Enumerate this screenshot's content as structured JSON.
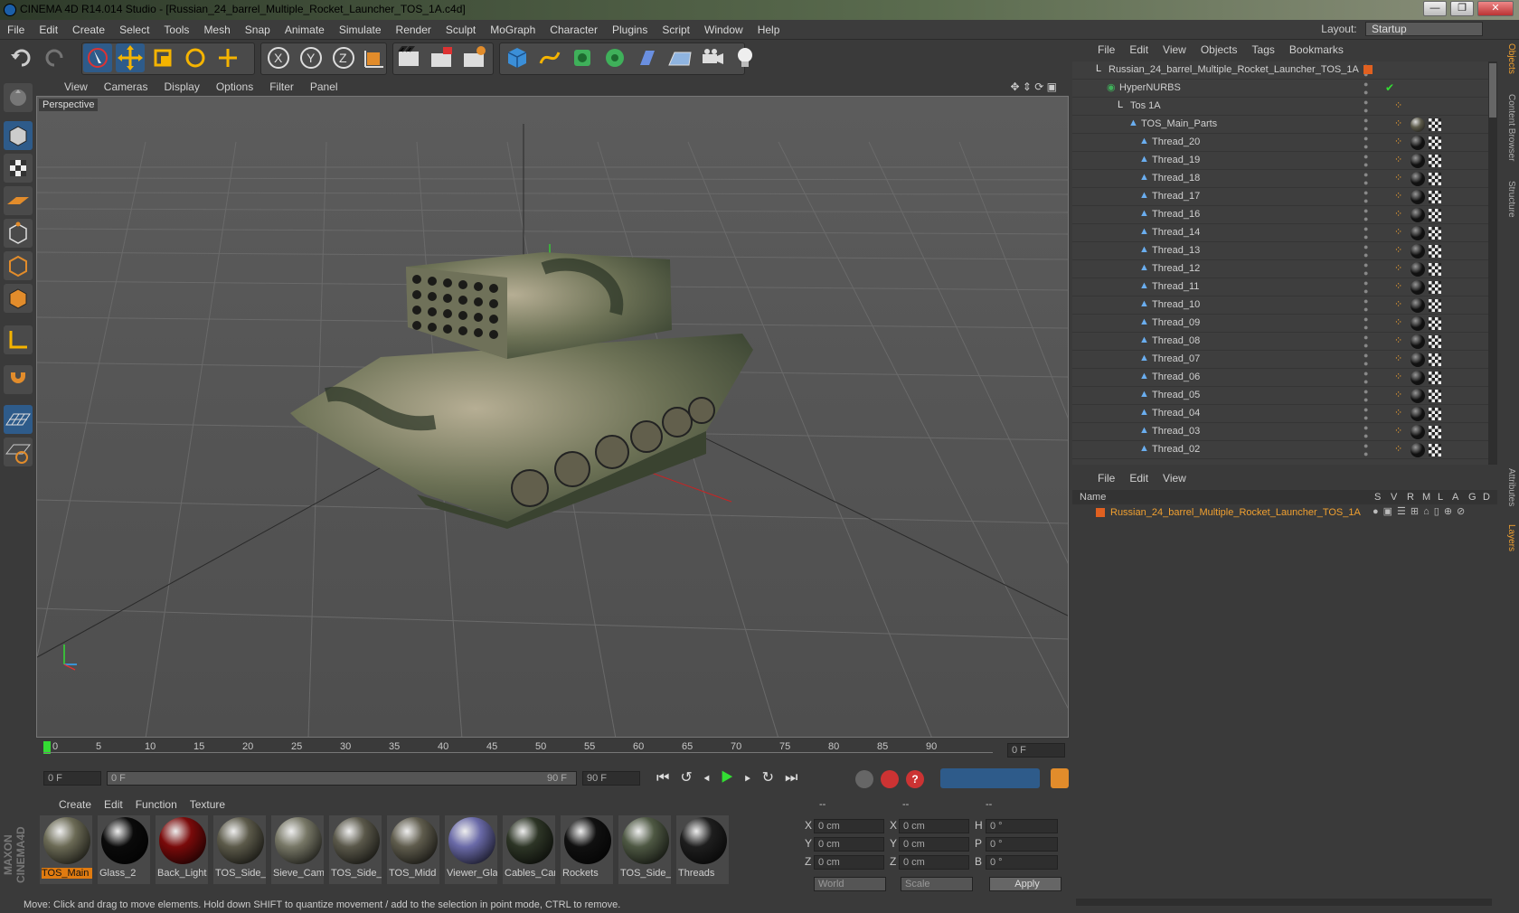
{
  "window": {
    "title": "CINEMA 4D R14.014 Studio - [Russian_24_barrel_Multiple_Rocket_Launcher_TOS_1A.c4d]",
    "buttons": [
      "—",
      "❐",
      "✕"
    ]
  },
  "menubar": {
    "items": [
      "File",
      "Edit",
      "Create",
      "Select",
      "Tools",
      "Mesh",
      "Snap",
      "Animate",
      "Simulate",
      "Render",
      "Sculpt",
      "MoGraph",
      "Character",
      "Plugins",
      "Script",
      "Window",
      "Help"
    ],
    "layout_label": "Layout:",
    "layout_value": "Startup"
  },
  "viewport": {
    "menu": [
      "View",
      "Cameras",
      "Display",
      "Options",
      "Filter",
      "Panel"
    ],
    "label": "Perspective"
  },
  "timeline": {
    "ticks": [
      "0",
      "5",
      "10",
      "15",
      "20",
      "25",
      "30",
      "35",
      "40",
      "45",
      "50",
      "55",
      "60",
      "65",
      "70",
      "75",
      "80",
      "85",
      "90"
    ],
    "frame_field": "0 F",
    "start_field": "0 F",
    "range_start": "0 F",
    "range_end": "90 F",
    "end_field": "90 F"
  },
  "materials": {
    "menu": [
      "Create",
      "Edit",
      "Function",
      "Texture"
    ],
    "items": [
      {
        "label": "TOS_Main",
        "color": "#6b6a55",
        "selected": true
      },
      {
        "label": "Glass_2",
        "color": "#0a0a0a",
        "selected": false
      },
      {
        "label": "Back_Light",
        "color": "#7a0a0a",
        "selected": false
      },
      {
        "label": "TOS_Side_F",
        "color": "#5c5a4a",
        "selected": false
      },
      {
        "label": "Sieve_Camu",
        "color": "#777766",
        "selected": false
      },
      {
        "label": "TOS_Side_F",
        "color": "#5a584a",
        "selected": false
      },
      {
        "label": "TOS_Midd",
        "color": "#5f5c4d",
        "selected": false
      },
      {
        "label": "Viewer_Gla",
        "color": "#6a6aa8",
        "selected": false
      },
      {
        "label": "Cables_Car",
        "color": "#2d3526",
        "selected": false
      },
      {
        "label": "Rockets",
        "color": "#101010",
        "selected": false
      },
      {
        "label": "TOS_Side_F",
        "color": "#4e5843",
        "selected": false
      },
      {
        "label": "Threads",
        "color": "#1e1e1e",
        "selected": false
      }
    ]
  },
  "coordinates": {
    "headers": [
      "--",
      "--",
      "--"
    ],
    "rows": [
      {
        "a": "X",
        "av": "0 cm",
        "b": "X",
        "bv": "0 cm",
        "c": "H",
        "cv": "0 °"
      },
      {
        "a": "Y",
        "av": "0 cm",
        "b": "Y",
        "bv": "0 cm",
        "c": "P",
        "cv": "0 °"
      },
      {
        "a": "Z",
        "av": "0 cm",
        "b": "Z",
        "bv": "0 cm",
        "c": "B",
        "cv": "0 °"
      }
    ],
    "world": "World",
    "scale": "Scale",
    "apply": "Apply"
  },
  "object_manager": {
    "menu": [
      "File",
      "Edit",
      "View",
      "Objects",
      "Tags",
      "Bookmarks"
    ],
    "rows": [
      {
        "name": "Russian_24_barrel_Multiple_Rocket_Launcher_TOS_1A",
        "indent": 0
      },
      {
        "name": "HyperNURBS",
        "indent": 1
      },
      {
        "name": "Tos 1A",
        "indent": 2
      },
      {
        "name": "TOS_Main_Parts",
        "indent": 3
      },
      {
        "name": "Thread_20",
        "indent": 4
      },
      {
        "name": "Thread_19",
        "indent": 4
      },
      {
        "name": "Thread_18",
        "indent": 4
      },
      {
        "name": "Thread_17",
        "indent": 4
      },
      {
        "name": "Thread_16",
        "indent": 4
      },
      {
        "name": "Thread_14",
        "indent": 4
      },
      {
        "name": "Thread_13",
        "indent": 4
      },
      {
        "name": "Thread_12",
        "indent": 4
      },
      {
        "name": "Thread_11",
        "indent": 4
      },
      {
        "name": "Thread_10",
        "indent": 4
      },
      {
        "name": "Thread_09",
        "indent": 4
      },
      {
        "name": "Thread_08",
        "indent": 4
      },
      {
        "name": "Thread_07",
        "indent": 4
      },
      {
        "name": "Thread_06",
        "indent": 4
      },
      {
        "name": "Thread_05",
        "indent": 4
      },
      {
        "name": "Thread_04",
        "indent": 4
      },
      {
        "name": "Thread_03",
        "indent": 4
      },
      {
        "name": "Thread_02",
        "indent": 4
      }
    ]
  },
  "layer_manager": {
    "menu": [
      "File",
      "Edit",
      "View"
    ],
    "columns": [
      "Name",
      "S",
      "V",
      "R",
      "M",
      "L",
      "A",
      "G",
      "D"
    ],
    "layer": "Russian_24_barrel_Multiple_Rocket_Launcher_TOS_1A"
  },
  "side_tabs": [
    "Objects",
    "Content Browser",
    "Structure",
    "Attributes",
    "Layers"
  ],
  "status": "Move: Click and drag to move elements. Hold down SHIFT to quantize movement / add to the selection in point mode, CTRL to remove.",
  "brand": "MAXON CINEMA4D"
}
